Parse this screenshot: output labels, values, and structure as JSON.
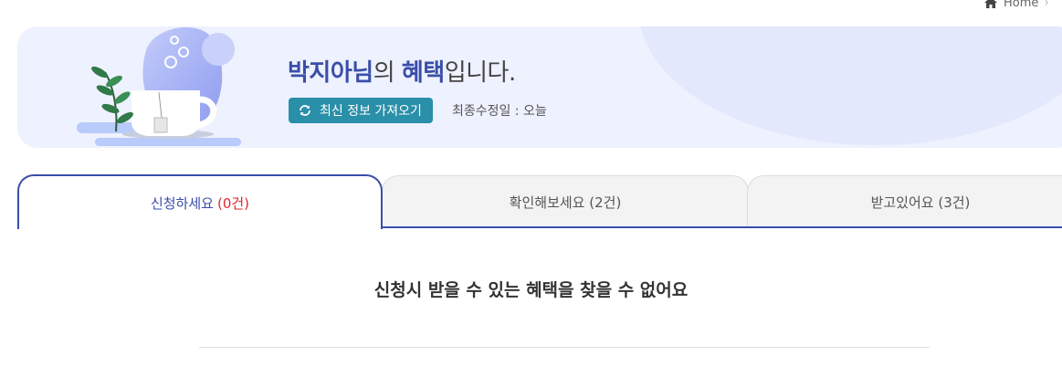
{
  "breadcrumb": {
    "home_label": "Home",
    "home_icon": "home-icon",
    "chevron_icon": "chevron-right-icon"
  },
  "banner": {
    "user_name": "박지아님",
    "title_mid": "의 ",
    "title_benefit": "혜택",
    "title_end": "입니다.",
    "refresh_label": "최신 정보 가져오기",
    "refresh_icon": "refresh-icon",
    "modified_text": "최종수정일 : 오늘",
    "illustration": "tea-cup-illustration"
  },
  "tabs": [
    {
      "label": "신청하세요",
      "count": "(0건)",
      "active": true
    },
    {
      "label": "확인해보세요",
      "count": "(2건)",
      "active": false
    },
    {
      "label": "받고있어요",
      "count": "(3건)",
      "active": false
    }
  ],
  "content": {
    "empty_message": "신청시 받을 수 있는 혜택을 찾을 수 없어요"
  },
  "colors": {
    "accent": "#3a4ea8",
    "button": "#2a8fa8",
    "count_active": "#e0262a",
    "banner_bg": "#eef1fe"
  }
}
